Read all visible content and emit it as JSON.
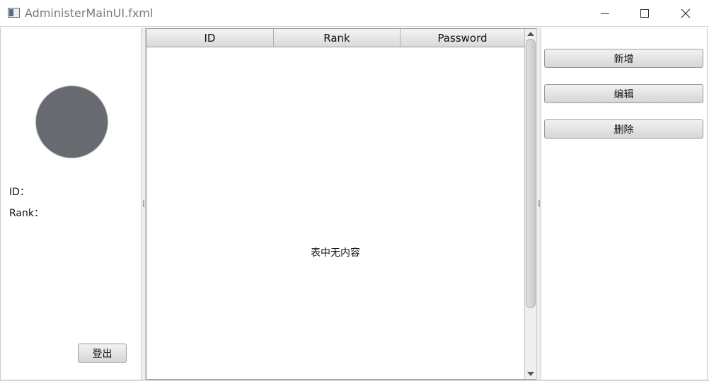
{
  "window": {
    "title": "AdministerMainUI.fxml"
  },
  "left_panel": {
    "id_label": "ID：",
    "rank_label": "Rank：",
    "logout_label": "登出"
  },
  "table": {
    "columns": [
      "ID",
      "Rank",
      "Password"
    ],
    "empty_message": "表中无内容"
  },
  "right_panel": {
    "add_label": "新增",
    "edit_label": "编辑",
    "delete_label": "删除"
  },
  "colors": {
    "avatar": "#676a6e",
    "button_gradient_top": "#f2f2f2",
    "button_gradient_bottom": "#d6d6d6"
  }
}
